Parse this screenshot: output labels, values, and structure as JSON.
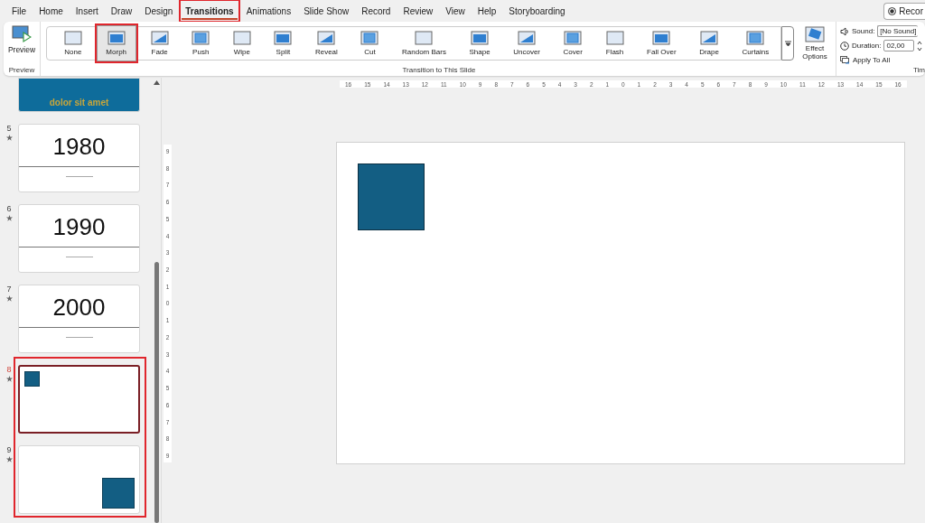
{
  "menu_tabs": [
    {
      "label": "File",
      "selected": false
    },
    {
      "label": "Home",
      "selected": false
    },
    {
      "label": "Insert",
      "selected": false
    },
    {
      "label": "Draw",
      "selected": false
    },
    {
      "label": "Design",
      "selected": false
    },
    {
      "label": "Transitions",
      "selected": true
    },
    {
      "label": "Animations",
      "selected": false
    },
    {
      "label": "Slide Show",
      "selected": false
    },
    {
      "label": "Record",
      "selected": false
    },
    {
      "label": "Review",
      "selected": false
    },
    {
      "label": "View",
      "selected": false
    },
    {
      "label": "Help",
      "selected": false
    },
    {
      "label": "Storyboarding",
      "selected": false
    }
  ],
  "record_button": "Recor",
  "preview_group": {
    "button": "Preview",
    "label": "Preview"
  },
  "transitions": [
    {
      "label": "None",
      "selected": false
    },
    {
      "label": "Morph",
      "selected": true
    },
    {
      "label": "Fade",
      "selected": false
    },
    {
      "label": "Push",
      "selected": false
    },
    {
      "label": "Wipe",
      "selected": false
    },
    {
      "label": "Split",
      "selected": false
    },
    {
      "label": "Reveal",
      "selected": false
    },
    {
      "label": "Cut",
      "selected": false
    },
    {
      "label": "Random Bars",
      "selected": false
    },
    {
      "label": "Shape",
      "selected": false
    },
    {
      "label": "Uncover",
      "selected": false
    },
    {
      "label": "Cover",
      "selected": false
    },
    {
      "label": "Flash",
      "selected": false
    },
    {
      "label": "Fall Over",
      "selected": false
    },
    {
      "label": "Drape",
      "selected": false
    },
    {
      "label": "Curtains",
      "selected": false
    }
  ],
  "transitions_group_label": "Transition to This Slide",
  "effect_options": "Effect Options",
  "timing": {
    "sound_label": "Sound:",
    "sound_value": "[No Sound]",
    "duration_label": "Duration:",
    "duration_value": "02,00",
    "apply_all": "Apply To All",
    "group_label": "Tim"
  },
  "partial_slide": {
    "text": "dolor sit amet"
  },
  "slides": [
    {
      "number": "5",
      "kind": "title",
      "title": "1980",
      "selected": false
    },
    {
      "number": "6",
      "kind": "title",
      "title": "1990",
      "selected": false
    },
    {
      "number": "7",
      "kind": "title",
      "title": "2000",
      "selected": false
    },
    {
      "number": "8",
      "kind": "square-top-left",
      "selected": true
    },
    {
      "number": "9",
      "kind": "square-bottom-right",
      "selected": false
    }
  ],
  "ruler_horizontal": [
    "16",
    "15",
    "14",
    "13",
    "12",
    "11",
    "10",
    "9",
    "8",
    "7",
    "6",
    "5",
    "4",
    "3",
    "2",
    "1",
    "0",
    "1",
    "2",
    "3",
    "4",
    "5",
    "6",
    "7",
    "8",
    "9",
    "10",
    "11",
    "12",
    "13",
    "14",
    "15",
    "16"
  ],
  "ruler_vertical": [
    "9",
    "8",
    "7",
    "6",
    "5",
    "4",
    "3",
    "2",
    "1",
    "0",
    "1",
    "2",
    "3",
    "4",
    "5",
    "6",
    "7",
    "8",
    "9"
  ]
}
